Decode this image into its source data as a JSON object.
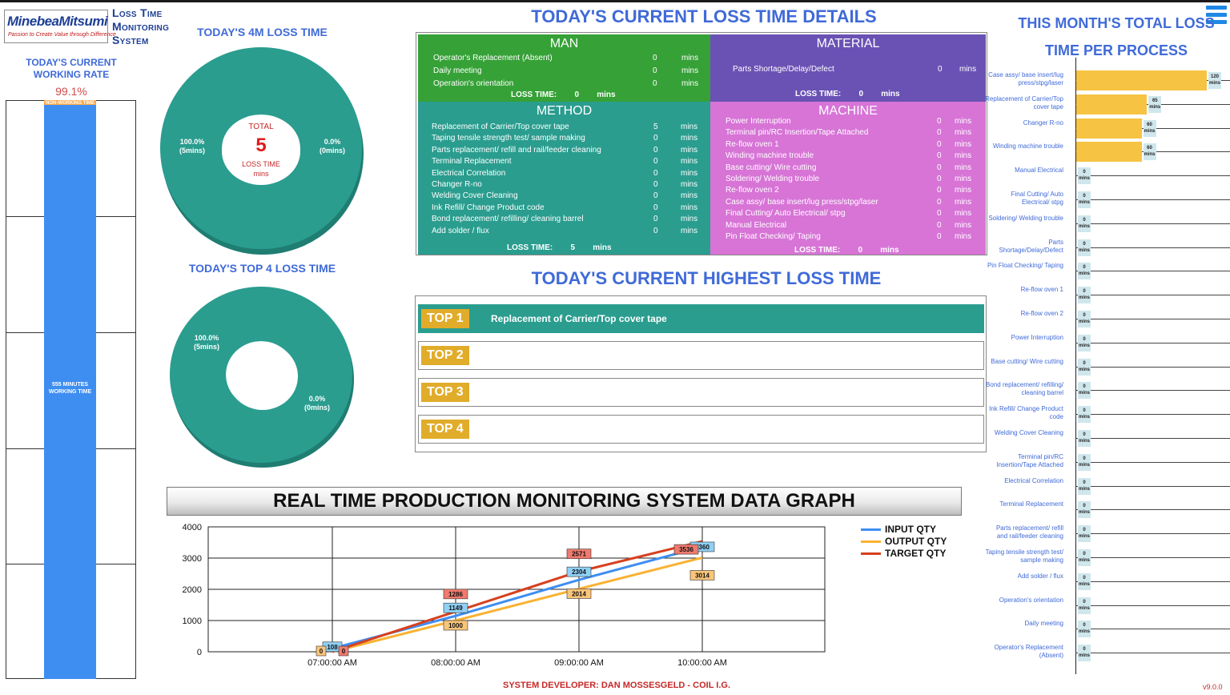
{
  "app": {
    "logo_text": "MinebeaMitsumi",
    "logo_tagline": "Passion to Create Value through Difference",
    "system_title_lines": [
      "Loss Time",
      "Monitoring",
      "System"
    ],
    "version": "v9.0.0"
  },
  "colors": {
    "heading_blue": "#3f6ad8",
    "teal": "#2a9d8f",
    "man": "#36a137",
    "material": "#6a52b4",
    "method": "#2a9d8f",
    "machine": "#d774d6",
    "working_bar": "#3e8ef2",
    "nonworking": "#f9a94a",
    "process_bar": "#f6c342",
    "top_tag": "#e0ac2a"
  },
  "working_rate": {
    "title": "TODAY'S CURRENT WORKING RATE",
    "value": "99.1%",
    "nonworking_label": "NON-WORKING TIME",
    "working_label": "555 MINUTES WORKING TIME"
  },
  "loss_4m": {
    "title": "TODAY'S 4M LOSS TIME",
    "left_label": "100.0%\n(5mins)",
    "right_label": "0.0%\n(0mins)",
    "total_label": "TOTAL",
    "total_value": "5",
    "loss_label": "LOSS TIME",
    "unit": "mins"
  },
  "top4_donut": {
    "title": "TODAY'S TOP 4 LOSS TIME",
    "label_a": "100.0%\n(5mins)",
    "label_b": "0.0%\n(0mins)"
  },
  "details": {
    "title": "TODAY'S CURRENT LOSS TIME DETAILS",
    "man": {
      "title": "MAN",
      "rows": [
        {
          "label": "Operator's Replacement (Absent)",
          "value": "0",
          "unit": "mins"
        },
        {
          "label": "Daily meeting",
          "value": "0",
          "unit": "mins"
        },
        {
          "label": "Operation's orientation",
          "value": "0",
          "unit": "mins"
        }
      ],
      "loss_label": "LOSS TIME:",
      "loss_value": "0",
      "loss_unit": "mins"
    },
    "material": {
      "title": "MATERIAL",
      "rows": [
        {
          "label": "Parts Shortage/Delay/Defect",
          "value": "0",
          "unit": "mins"
        }
      ],
      "loss_label": "LOSS TIME:",
      "loss_value": "0",
      "loss_unit": "mins"
    },
    "method": {
      "title": "METHOD",
      "rows": [
        {
          "label": "Replacement of Carrier/Top cover tape",
          "value": "5",
          "unit": "mins"
        },
        {
          "label": "Taping tensile strength test/ sample making",
          "value": "0",
          "unit": "mins"
        },
        {
          "label": "Parts replacement/ refill and rail/feeder cleaning",
          "value": "0",
          "unit": "mins"
        },
        {
          "label": "Terminal Replacement",
          "value": "0",
          "unit": "mins"
        },
        {
          "label": "Electrical Correlation",
          "value": "0",
          "unit": "mins"
        },
        {
          "label": "Changer R-no",
          "value": "0",
          "unit": "mins"
        },
        {
          "label": "Welding Cover Cleaning",
          "value": "0",
          "unit": "mins"
        },
        {
          "label": "Ink Refill/ Change Product code",
          "value": "0",
          "unit": "mins"
        },
        {
          "label": "Bond replacement/ refilling/ cleaning barrel",
          "value": "0",
          "unit": "mins"
        },
        {
          "label": "Add solder / flux",
          "value": "0",
          "unit": "mins"
        }
      ],
      "loss_label": "LOSS TIME:",
      "loss_value": "5",
      "loss_unit": "mins"
    },
    "machine": {
      "title": "MACHINE",
      "rows": [
        {
          "label": "Power Interruption",
          "value": "0",
          "unit": "mins"
        },
        {
          "label": "Terminal pin/RC Insertion/Tape Attached",
          "value": "0",
          "unit": "mins"
        },
        {
          "label": "Re-flow oven 1",
          "value": "0",
          "unit": "mins"
        },
        {
          "label": "Winding machine trouble",
          "value": "0",
          "unit": "mins"
        },
        {
          "label": "Base cutting/ Wire cutting",
          "value": "0",
          "unit": "mins"
        },
        {
          "label": "Soldering/ Welding trouble",
          "value": "0",
          "unit": "mins"
        },
        {
          "label": "Re-flow oven 2",
          "value": "0",
          "unit": "mins"
        },
        {
          "label": "Case assy/ base insert/lug press/stpg/laser",
          "value": "0",
          "unit": "mins"
        },
        {
          "label": "Final Cutting/ Auto Electrical/ stpg",
          "value": "0",
          "unit": "mins"
        },
        {
          "label": "Manual Electrical",
          "value": "0",
          "unit": "mins"
        },
        {
          "label": "Pin Float Checking/ Taping",
          "value": "0",
          "unit": "mins"
        }
      ],
      "loss_label": "LOSS TIME:",
      "loss_value": "0",
      "loss_unit": "mins"
    }
  },
  "highest": {
    "title": "TODAY'S CURRENT HIGHEST LOSS TIME",
    "items": [
      {
        "tag": "TOP 1",
        "text": "Replacement of Carrier/Top cover tape"
      },
      {
        "tag": "TOP 2",
        "text": ""
      },
      {
        "tag": "TOP 3",
        "text": ""
      },
      {
        "tag": "TOP 4",
        "text": ""
      }
    ]
  },
  "graph": {
    "banner": "REAL TIME PRODUCTION MONITORING SYSTEM DATA GRAPH"
  },
  "chart_data": [
    {
      "type": "line",
      "categories": [
        "07:00:00 AM",
        "08:00:00 AM",
        "09:00:00 AM",
        "10:00:00 AM"
      ],
      "ylim": [
        0,
        4000
      ],
      "yticks": [
        0,
        1000,
        2000,
        3000,
        4000
      ],
      "grid": true,
      "legend": "right",
      "series": [
        {
          "name": "INPUT QTY",
          "color": "#3e8ef2",
          "values": [
            108,
            1149,
            2304,
            3360
          ]
        },
        {
          "name": "OUTPUT QTY",
          "color": "#f9b233",
          "values": [
            0,
            1000,
            2014,
            3014
          ]
        },
        {
          "name": "TARGET QTY",
          "color": "#d7401e",
          "values": [
            0,
            1286,
            2571,
            3536
          ]
        }
      ]
    },
    {
      "type": "bar",
      "orientation": "horizontal",
      "title": "THIS MONTH'S TOTAL LOSS TIME PER PROCESS",
      "unit": "mins",
      "categories": [
        "Case assy/ base insert/lug press/stpg/laser",
        "Replacement of Carrier/Top cover tape",
        "Changer R-no",
        "Winding machine trouble",
        "Manual Electrical",
        "Final Cutting/ Auto Electrical/ stpg",
        "Soldering/ Welding trouble",
        "Parts Shortage/Delay/Defect",
        "Pin Float Checking/ Taping",
        "Re-flow oven 1",
        "Re-flow oven 2",
        "Power Interruption",
        "Base cutting/ Wire cutting",
        "Bond replacement/ refilling/ cleaning barrel",
        "Ink Refill/ Change Product code",
        "Welding Cover Cleaning",
        "Terminal pin/RC Insertion/Tape Attached",
        "Electrical Correlation",
        "Terminal Replacement",
        "Parts replacement/ refill and rail/feeder cleaning",
        "Taping tensile strength test/ sample making",
        "Add solder / flux",
        "Operation's orientation",
        "Daily meeting",
        "Operator's Replacement (Absent)"
      ],
      "values": [
        120,
        65,
        60,
        60,
        0,
        0,
        0,
        0,
        0,
        0,
        0,
        0,
        0,
        0,
        0,
        0,
        0,
        0,
        0,
        0,
        0,
        0,
        0,
        0,
        0
      ],
      "xlim": [
        0,
        120
      ]
    }
  ],
  "footer": {
    "developer": "SYSTEM DEVELOPER:  DAN MOSSESGELD - COIL I.G."
  }
}
